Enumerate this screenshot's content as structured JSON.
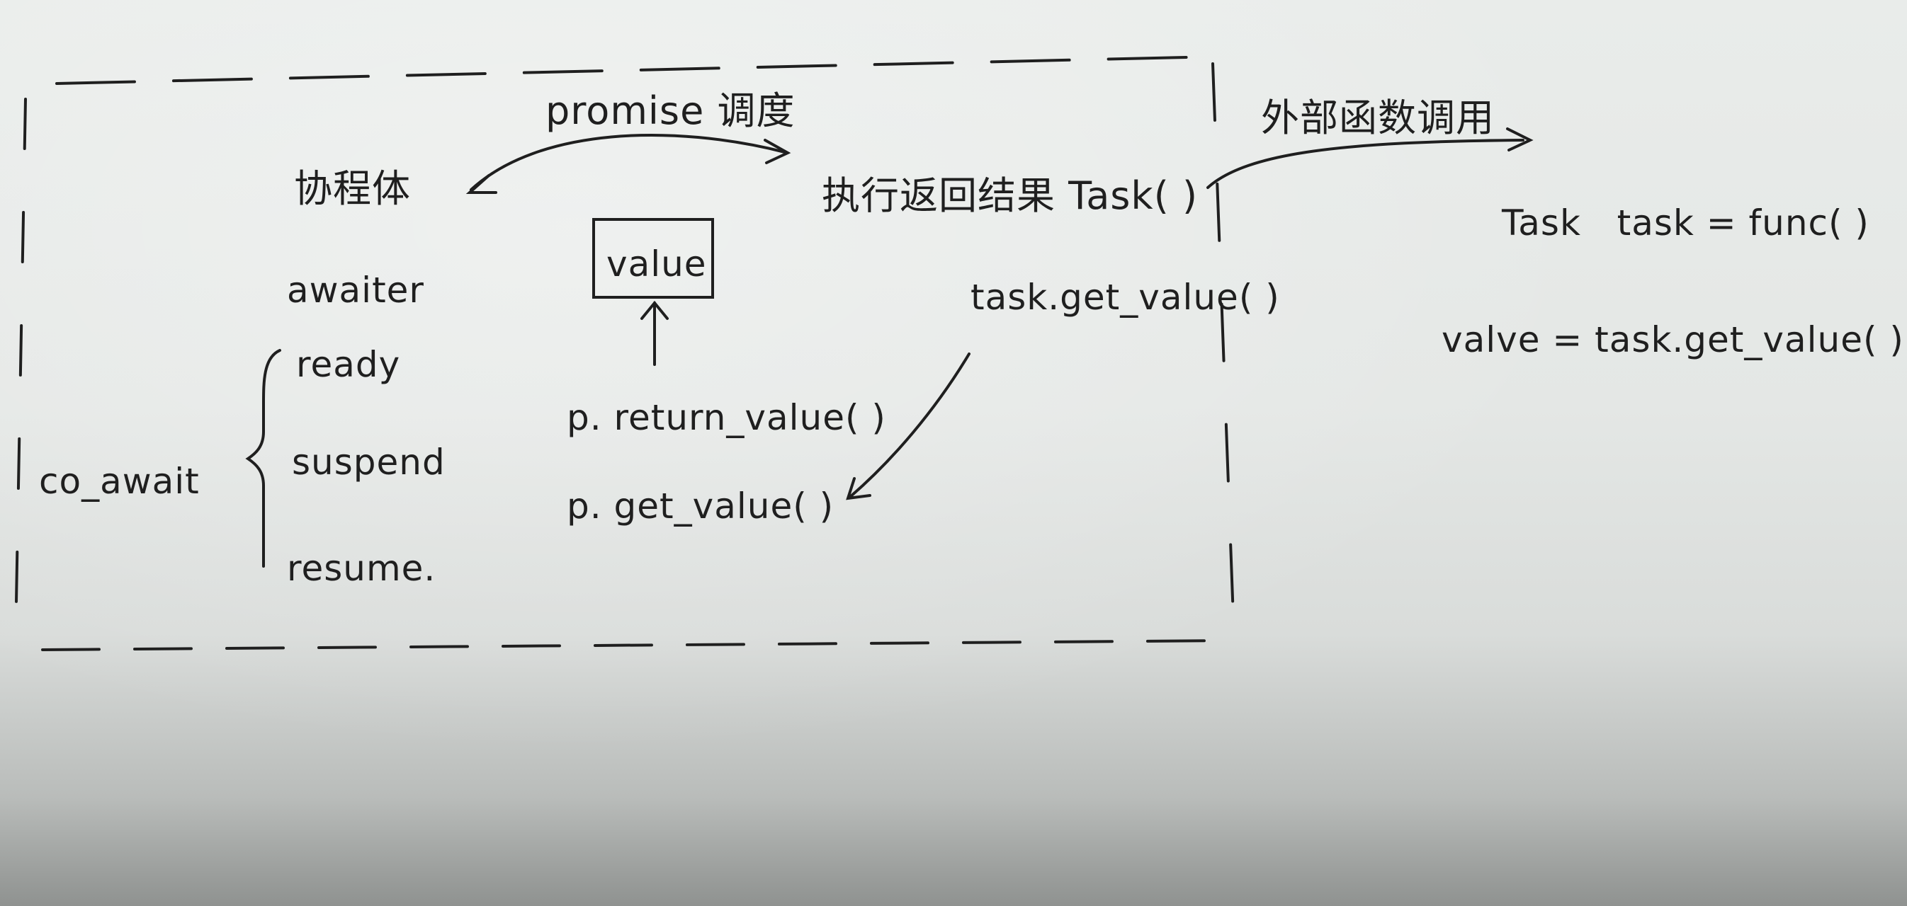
{
  "diagram": {
    "labels": {
      "promise_schedule": "promise 调度",
      "coroutine_body": "协程体",
      "return_result_task": "执行返回结果 Task( )",
      "external_call": "外部函数调用",
      "awaiter": "awaiter",
      "ready": "ready",
      "suspend": "suspend",
      "resume": "resume.",
      "co_await": "co_await",
      "value_box": "value",
      "return_value": "p. return_value( )",
      "get_value_p": "p. get_value( )",
      "task_get_value": "task.get_value( )",
      "task_decl": "Task   task = func( )",
      "value_assign": "valve = task.get_value( )"
    },
    "colors": {
      "ink": "#1f1f1f",
      "paper": "#e6e9e7"
    }
  }
}
